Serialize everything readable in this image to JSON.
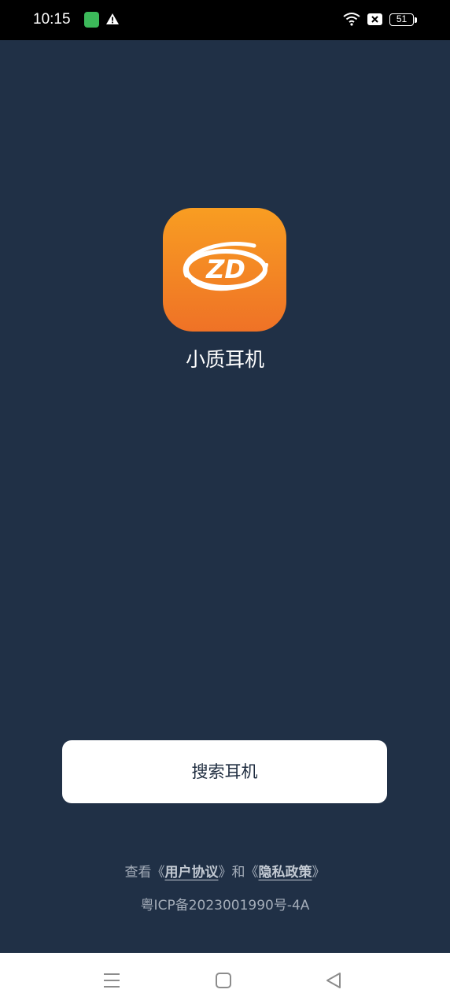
{
  "status_bar": {
    "time": "10:15",
    "battery_level": "51",
    "icons": [
      "app-notification-icon",
      "warning-icon",
      "wifi-icon",
      "sim-icon",
      "battery-icon"
    ]
  },
  "app": {
    "name": "小质耳机",
    "logo_icon": "zd-logo-icon",
    "logo_text": "ZD",
    "logo_colors": [
      "#f89d22",
      "#ef7226"
    ]
  },
  "main": {
    "search_button_label": "搜索耳机"
  },
  "footer": {
    "view_prefix": "查看《",
    "user_agreement": "用户协议",
    "conjunction": "》和《",
    "privacy_policy": "隐私政策",
    "suffix": "》",
    "icp": "粤ICP备2023001990号-4A"
  },
  "colors": {
    "background": "#203046",
    "button_bg": "#ffffff",
    "button_text": "#1f2d40",
    "footer_text": "#a4adb9"
  },
  "nav": {
    "icons": [
      "menu-icon",
      "home-icon",
      "back-icon"
    ]
  }
}
